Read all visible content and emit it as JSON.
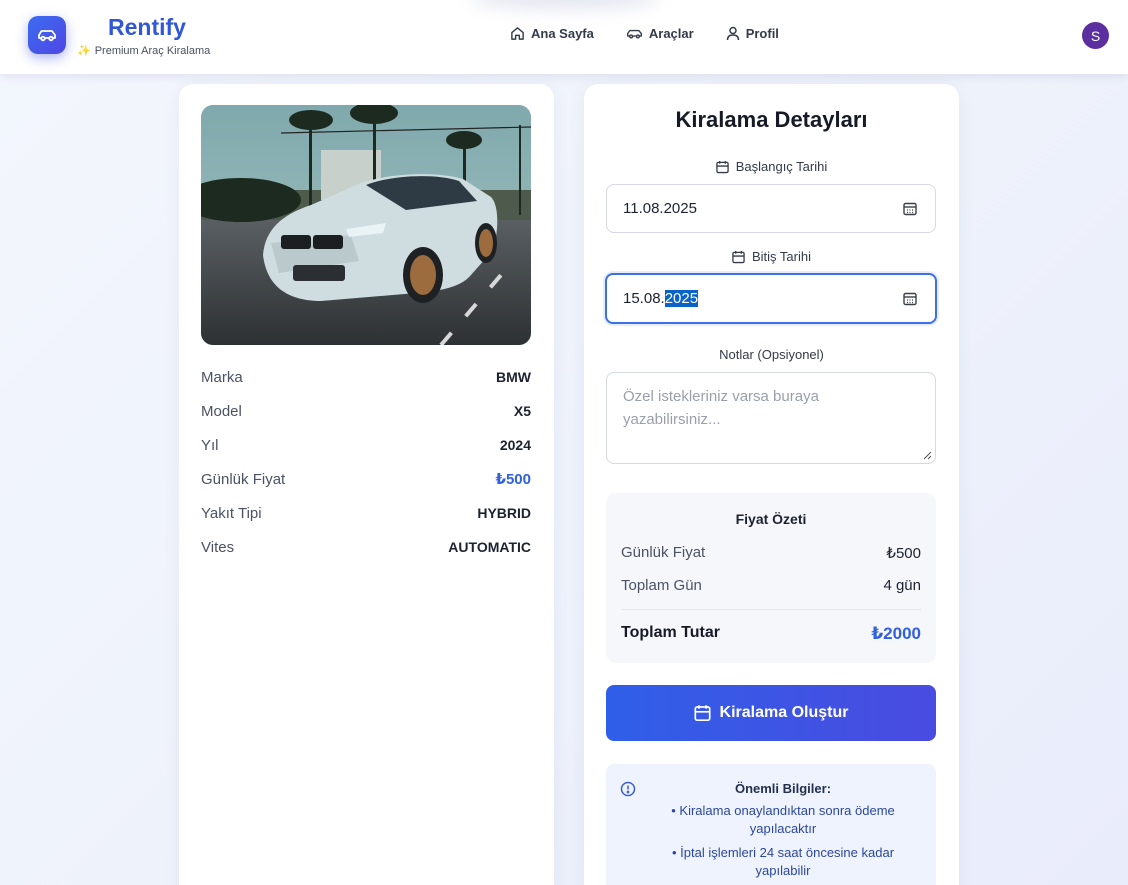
{
  "header": {
    "brand": "Rentify",
    "tagline": "Premium Araç Kiralama",
    "nav": [
      {
        "label": "Ana Sayfa",
        "icon": "home-icon"
      },
      {
        "label": "Araçlar",
        "icon": "car-icon"
      },
      {
        "label": "Profil",
        "icon": "user-icon"
      }
    ],
    "avatar_initial": "S",
    "brand_color": "#3157d8"
  },
  "car": {
    "photo": "white-bmw-sedan-on-road-with-palm-trees",
    "specs": [
      {
        "label": "Marka",
        "value": "BMW"
      },
      {
        "label": "Model",
        "value": "X5"
      },
      {
        "label": "Yıl",
        "value": "2024"
      },
      {
        "label": "Günlük Fiyat",
        "value": "₺500"
      },
      {
        "label": "Yakıt Tipi",
        "value": "HYBRID"
      },
      {
        "label": "Vites",
        "value": "AUTOMATIC"
      }
    ]
  },
  "rental": {
    "title": "Kiralama Detayları",
    "start_label": "Başlangıç Tarihi",
    "start_value": "11.08.2025",
    "end_label": "Bitiş Tarihi",
    "end_value_prefix": "15.08.",
    "end_value_selected": "2025",
    "notes_label": "Notlar (Opsiyonel)",
    "notes_placeholder": "Özel istekleriniz varsa buraya yazabilirsiniz..."
  },
  "summary": {
    "title": "Fiyat Özeti",
    "daily_label": "Günlük Fiyat",
    "daily_value": "₺500",
    "days_label": "Toplam Gün",
    "days_value": "4 gün",
    "total_label": "Toplam Tutar",
    "total_value": "₺2000",
    "accent": "#3060e0"
  },
  "cta": {
    "label": "Kiralama Oluştur"
  },
  "info": {
    "title": "Önemli Bilgiler:",
    "items": [
      "• Kiralama onaylandıktan sonra ödeme yapılacaktır",
      "• İptal işlemleri 24 saat öncesine kadar yapılabilir"
    ]
  }
}
